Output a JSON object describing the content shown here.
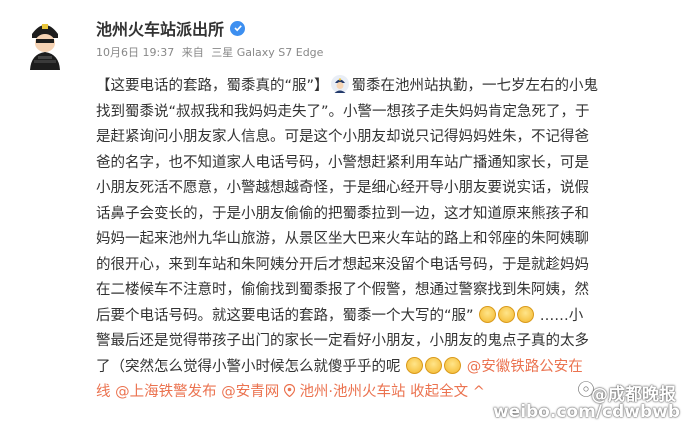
{
  "account": {
    "name": "池州火车站派出所",
    "avatar_icon": "police-avatar-icon",
    "verified_icon": "verified-badge-icon"
  },
  "meta": {
    "time": "10月6日 19:37",
    "source_prefix": "来自",
    "source": "三星 Galaxy S7 Edge"
  },
  "post": {
    "line1_bracket": "【这要电话的套路，蜀黍真的“服”】",
    "line1_text": "蜀黍在池州站执勤，一七岁左右的小鬼",
    "line2": "找到蜀黍说“叔叔我和我妈妈走失了”。小警一想孩子走失妈妈肯定急死了，于",
    "line3": "是赶紧询问小朋友家人信息。可是这个小朋友却说只记得妈妈姓朱，不记得爸",
    "line4": "爸的名字，也不知道家人电话号码，小警想赶紧利用车站广播通知家长，可是",
    "line5": "小朋友死活不愿意，小警越想越奇怪，于是细心经开导小朋友要说实话，说假",
    "line6": "话鼻子会变长的，于是小朋友偷偷的把蜀黍拉到一边，这才知道原来熊孩子和",
    "line7": "妈妈一起来池州九华山旅游，从景区坐大巴来火车站的路上和邻座的朱阿姨聊",
    "line8": "的很开心，来到车站和朱阿姨分开后才想起来没留个电话号码，于是就趁妈妈",
    "line9": "在二楼候车不注意时，偷偷找到蜀黍报了个假警，想通过警察找到朱阿姨，然",
    "line10_text": "后要个电话号码。就这要电话的套路，蜀黍一个大写的“服”",
    "line10_tail": "……小",
    "line11": "警最后还是觉得带孩子出门的家长一定看好小朋友，小朋友的鬼点子真的太多",
    "line12_text": "了（突然怎么觉得小警小时候怎么就傻乎乎的呢",
    "line12_link": "@安徽铁路公安在",
    "line13_link1": "线",
    "line13_link2": "@上海铁警发布",
    "line13_link3": "@安青网",
    "line13_loc": "池州·池州火车站",
    "line13_collapse": "收起全文",
    "line13_chevron": "^"
  },
  "watermark": {
    "line1": "@成都晚报",
    "line2": "weibo.com/cdwbwb"
  },
  "icons": {
    "police": "police-officer-icon",
    "laugh": "laugh-cry-emoji-icon",
    "dizzy": "dizzy-face-emoji-icon",
    "location": "location-pin-icon",
    "link": "link-icon"
  },
  "colors": {
    "link": "#eb7350",
    "verified": "#3d8ff0",
    "text": "#333333",
    "meta": "#888888"
  }
}
